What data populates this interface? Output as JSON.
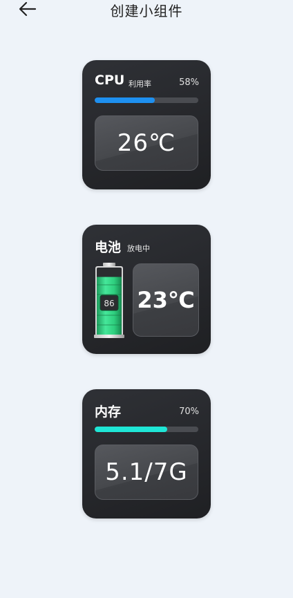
{
  "header": {
    "title": "创建小组件",
    "back_icon": "arrow-left-icon"
  },
  "cpu": {
    "title": "CPU",
    "subtitle": "利用率",
    "percent_label": "58%",
    "usage_fraction": 0.58,
    "value": "26℃",
    "bar_color": "#1e90f0"
  },
  "battery": {
    "title": "电池",
    "status": "放电中",
    "level": "86",
    "level_fraction": 0.86,
    "temperature": "23℃",
    "battery_color": "#2ecf7e"
  },
  "memory": {
    "title": "内存",
    "percent_label": "70%",
    "usage_fraction": 0.7,
    "value": "5.1/7G",
    "bar_color": "#1fe6d6"
  }
}
